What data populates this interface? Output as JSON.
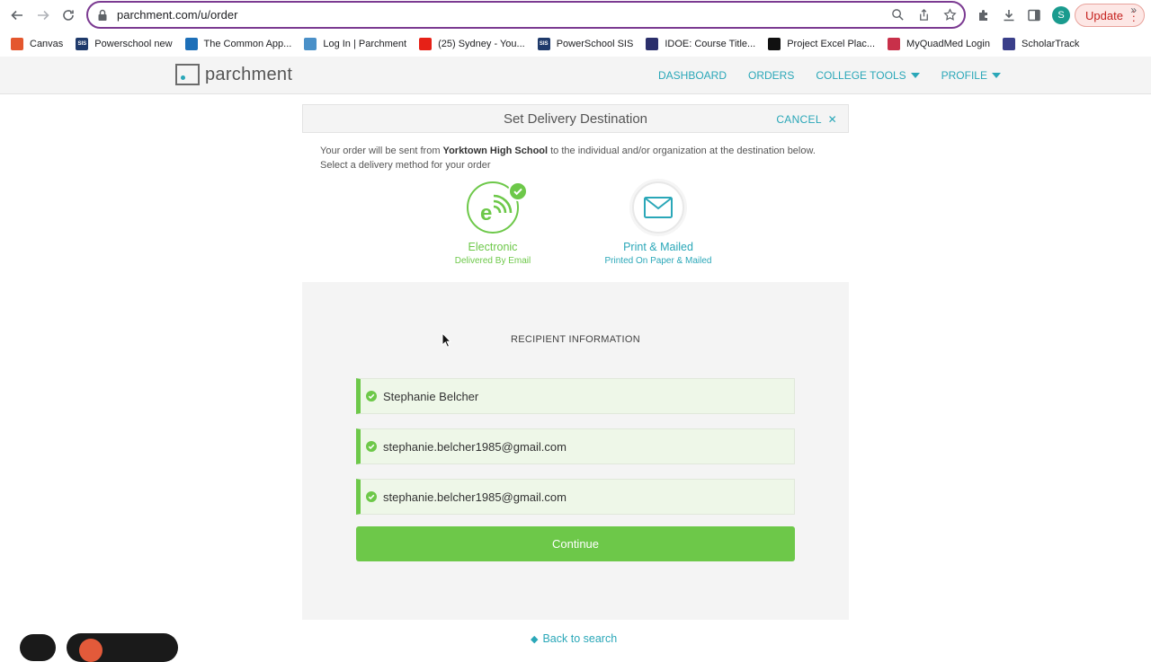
{
  "browser": {
    "url": "parchment.com/u/order",
    "update_label": "Update",
    "avatar_letter": "S",
    "bookmarks": [
      {
        "label": "Canvas",
        "color": "#e4572e"
      },
      {
        "label": "Powerschool new",
        "color": "#1f3a6b",
        "badge": "SIS"
      },
      {
        "label": "The Common App...",
        "color": "#1d6fb8"
      },
      {
        "label": "Log In | Parchment",
        "color": "#4a90c8"
      },
      {
        "label": "(25) Sydney - You...",
        "color": "#e62117"
      },
      {
        "label": "PowerSchool SIS",
        "color": "#1f3a6b",
        "badge": "SIS"
      },
      {
        "label": "IDOE: Course Title...",
        "color": "#2b2f6b"
      },
      {
        "label": "Project Excel Plac...",
        "color": "#111111"
      },
      {
        "label": "MyQuadMed Login",
        "color": "#c8304a"
      },
      {
        "label": "ScholarTrack",
        "color": "#3a3f8a"
      }
    ]
  },
  "site": {
    "logo": "parchment",
    "nav": {
      "dashboard": "DASHBOARD",
      "orders": "ORDERS",
      "college_tools": "COLLEGE TOOLS",
      "profile": "PROFILE"
    }
  },
  "delivery": {
    "title": "Set Delivery Destination",
    "cancel": "CANCEL",
    "intro_prefix": "Your order will be sent from ",
    "school": "Yorktown High School",
    "intro_suffix": " to the individual and/or organization at the destination below. Select a delivery method for your order",
    "methods": {
      "electronic": {
        "title": "Electronic",
        "subtitle": "Delivered By Email"
      },
      "print": {
        "title": "Print & Mailed",
        "subtitle": "Printed On Paper & Mailed"
      }
    }
  },
  "recipient": {
    "heading": "RECIPIENT INFORMATION",
    "name": "Stephanie Belcher",
    "email": "stephanie.belcher1985@gmail.com",
    "email_confirm": "stephanie.belcher1985@gmail.com",
    "continue": "Continue"
  },
  "footer": {
    "back": "Back to search"
  },
  "colors": {
    "accent": "#2aa7b8",
    "success": "#6dc849"
  }
}
